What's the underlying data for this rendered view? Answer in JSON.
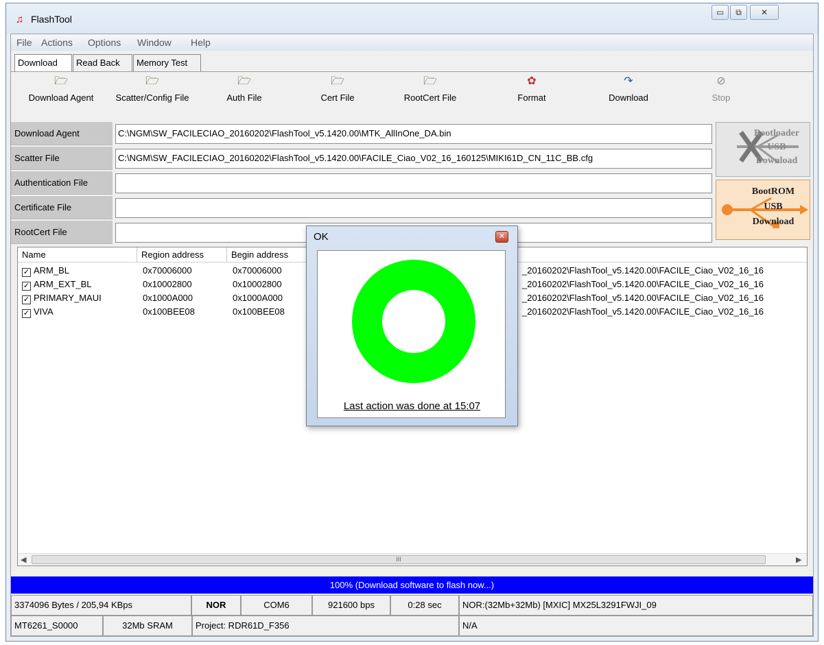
{
  "window": {
    "title": "FlashTool",
    "app_icon": "flashtool-icon",
    "controls": [
      "▭",
      "⧉",
      "✕"
    ]
  },
  "menu": [
    "File",
    "Actions",
    "Options",
    "Window",
    "Help"
  ],
  "tabs": [
    "Download",
    "Read Back",
    "Memory Test"
  ],
  "toolbar": [
    {
      "label": "Download Agent",
      "icon": "open-folder-icon"
    },
    {
      "label": "Scatter/Config File",
      "icon": "open-folder-icon"
    },
    {
      "label": "Auth File",
      "icon": "open-folder-icon"
    },
    {
      "label": "Cert File",
      "icon": "open-folder-icon"
    },
    {
      "label": "RootCert File",
      "icon": "open-folder-icon"
    },
    {
      "label": "Format",
      "icon": "format-icon"
    },
    {
      "label": "Download",
      "icon": "download-icon"
    },
    {
      "label": "Stop",
      "icon": "stop-icon"
    }
  ],
  "files": [
    {
      "label": "Download Agent",
      "value": "C:\\NGM\\SW_FACILECIAO_20160202\\FlashTool_v5.1420.00\\MTK_AllInOne_DA.bin"
    },
    {
      "label": "Scatter File",
      "value": "C:\\NGM\\SW_FACILECIAO_20160202\\FlashTool_v5.1420.00\\FACILE_Ciao_V02_16_160125\\MIKI61D_CN_11C_BB.cfg"
    },
    {
      "label": "Authentication File",
      "value": ""
    },
    {
      "label": "Certificate File",
      "value": ""
    },
    {
      "label": "RootCert File",
      "value": ""
    }
  ],
  "side_buttons": {
    "bootloader": [
      "Bootloader",
      "USB",
      "Download"
    ],
    "bootrom": [
      "BootROM",
      "USB",
      "Download"
    ]
  },
  "table": {
    "headers": [
      "Name",
      "Region address",
      "Begin address"
    ],
    "rows": [
      {
        "checked": true,
        "name": "ARM_BL",
        "region": "0x70006000",
        "begin": "0x70006000",
        "path": "_20160202\\FlashTool_v5.1420.00\\FACILE_Ciao_V02_16_16"
      },
      {
        "checked": true,
        "name": "ARM_EXT_BL",
        "region": "0x10002800",
        "begin": "0x10002800",
        "path": "_20160202\\FlashTool_v5.1420.00\\FACILE_Ciao_V02_16_16"
      },
      {
        "checked": true,
        "name": "PRIMARY_MAUI",
        "region": "0x1000A000",
        "begin": "0x1000A000",
        "path": "_20160202\\FlashTool_v5.1420.00\\FACILE_Ciao_V02_16_16"
      },
      {
        "checked": true,
        "name": "VIVA",
        "region": "0x100BEE08",
        "begin": "0x100BEE08",
        "path": "_20160202\\FlashTool_v5.1420.00\\FACILE_Ciao_V02_16_16"
      }
    ],
    "scroll_thumb": "III"
  },
  "progress": {
    "text": "100% (Download software to flash now...)",
    "percent": 100
  },
  "status1": [
    "3374096 Bytes / 205,94 KBps",
    "NOR",
    "COM6",
    "921600 bps",
    "0:28 sec",
    "NOR:(32Mb+32Mb) [MXIC] MX25L3291FWJI_09"
  ],
  "status2": [
    "MT6261_S0000",
    "32Mb SRAM",
    "Project: RDR61D_F356",
    "N/A"
  ],
  "dialog": {
    "title": "OK",
    "message": "Last action was done at 15:07",
    "ring_color": "#00ff00"
  }
}
